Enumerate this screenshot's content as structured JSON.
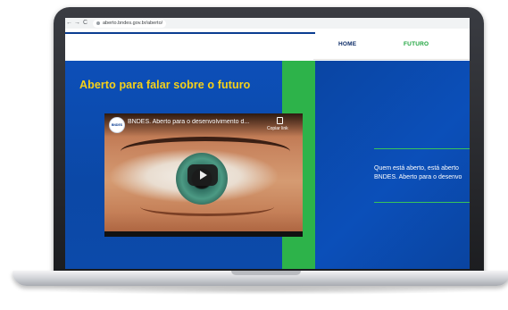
{
  "browser": {
    "nav_back": "←",
    "nav_forward": "→",
    "nav_reload": "C",
    "url": "aberto.bndes.gov.br/aberto/"
  },
  "header": {
    "nav": [
      {
        "label": "HOME"
      },
      {
        "label": "FUTURO"
      }
    ]
  },
  "hero": {
    "title": "Aberto para falar sobre o futuro"
  },
  "video": {
    "channel_logo_text": "BNDES",
    "title": "BNDES. Aberto para o desenvolvimento d...",
    "copy_label": "Copiar link",
    "play_icon": "play-icon"
  },
  "side": {
    "line1": "Quem está aberto, está aberto",
    "line2": "BNDES. Aberto para o desenvo"
  },
  "colors": {
    "brand_blue": "#0d49a8",
    "brand_green": "#2db34a",
    "title_yellow": "#f7d117",
    "nav_active": "#1aa33a"
  }
}
